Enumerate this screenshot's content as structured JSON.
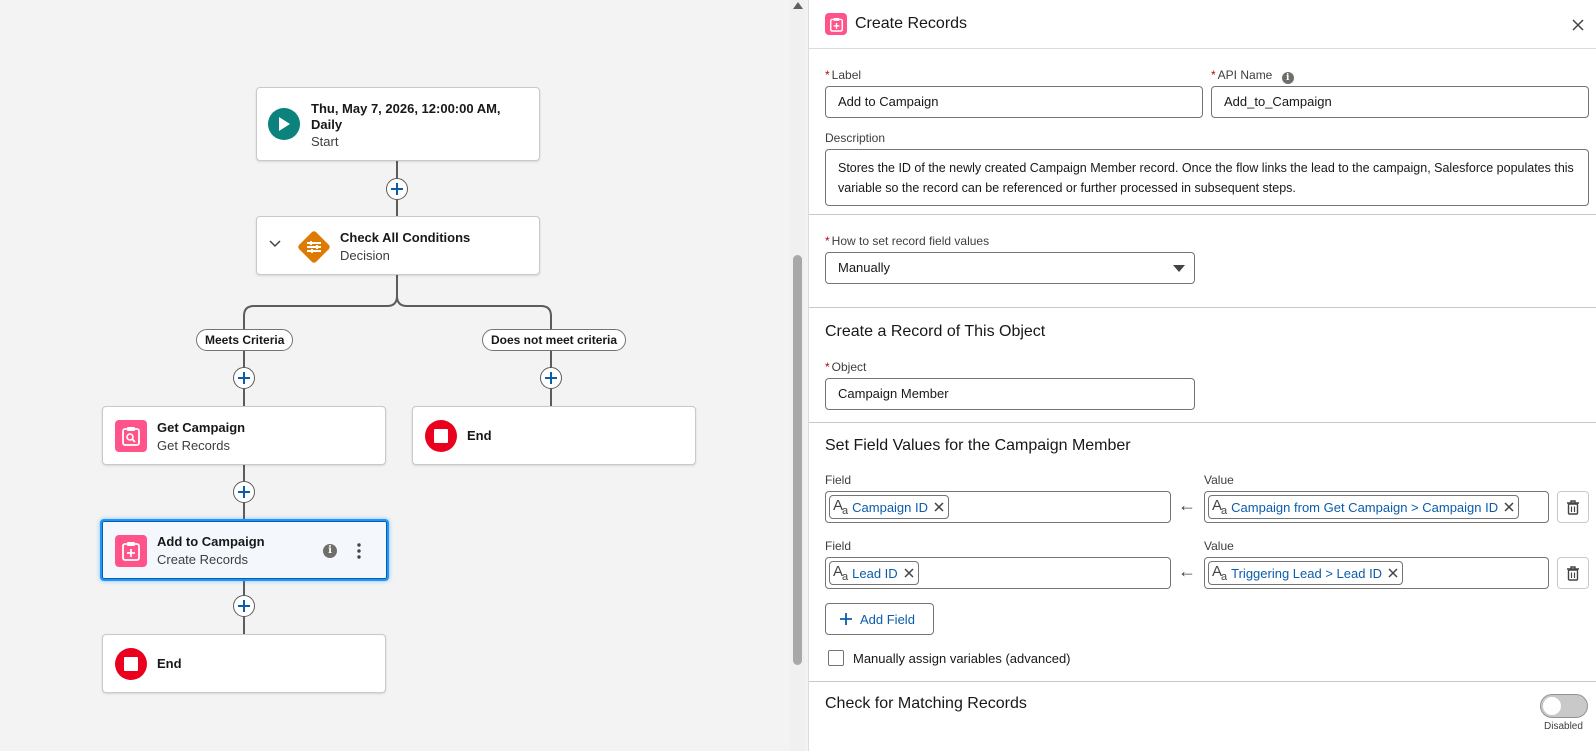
{
  "canvas": {
    "start": {
      "title_line1": "Thu, May 7, 2026, 12:00:00 AM,",
      "title_line2": "Daily",
      "subtitle": "Start"
    },
    "decision": {
      "title": "Check All Conditions",
      "subtitle": "Decision"
    },
    "branches": {
      "left": "Meets Criteria",
      "right": "Does not meet criteria"
    },
    "get_campaign": {
      "title": "Get Campaign",
      "subtitle": "Get Records"
    },
    "end_right": {
      "title": "End"
    },
    "add_campaign": {
      "title": "Add to Campaign",
      "subtitle": "Create Records"
    },
    "end_bottom": {
      "title": "End"
    },
    "colors": {
      "start": "#0b827c",
      "decision": "#dd7a01",
      "records": "#ff538a",
      "end": "#ea001e",
      "selected": "#1b96ff"
    }
  },
  "panel": {
    "title": "Create Records",
    "label": {
      "label": "Label",
      "value": "Add to Campaign"
    },
    "api_name": {
      "label": "API Name",
      "value": "Add_to_Campaign"
    },
    "description": {
      "label": "Description",
      "value": "Stores the ID of the newly created Campaign Member record. Once the flow links the lead to the campaign, Salesforce populates this variable so the record can be referenced or further processed in subsequent steps."
    },
    "how_to_set": {
      "label": "How to set record field values",
      "value": "Manually"
    },
    "create_section": {
      "title": "Create a Record of This Object",
      "object_label": "Object",
      "object_value": "Campaign Member"
    },
    "set_fields_section": {
      "title": "Set Field Values for the Campaign Member",
      "field_label": "Field",
      "value_label": "Value",
      "rows": [
        {
          "field": "Campaign ID",
          "value": "Campaign from Get Campaign > Campaign ID"
        },
        {
          "field": "Lead ID",
          "value": "Triggering Lead > Lead ID"
        }
      ],
      "add_field": "Add Field"
    },
    "manual_assign": "Manually assign variables (advanced)",
    "matching": {
      "title": "Check for Matching Records",
      "toggle_status": "Disabled"
    }
  }
}
